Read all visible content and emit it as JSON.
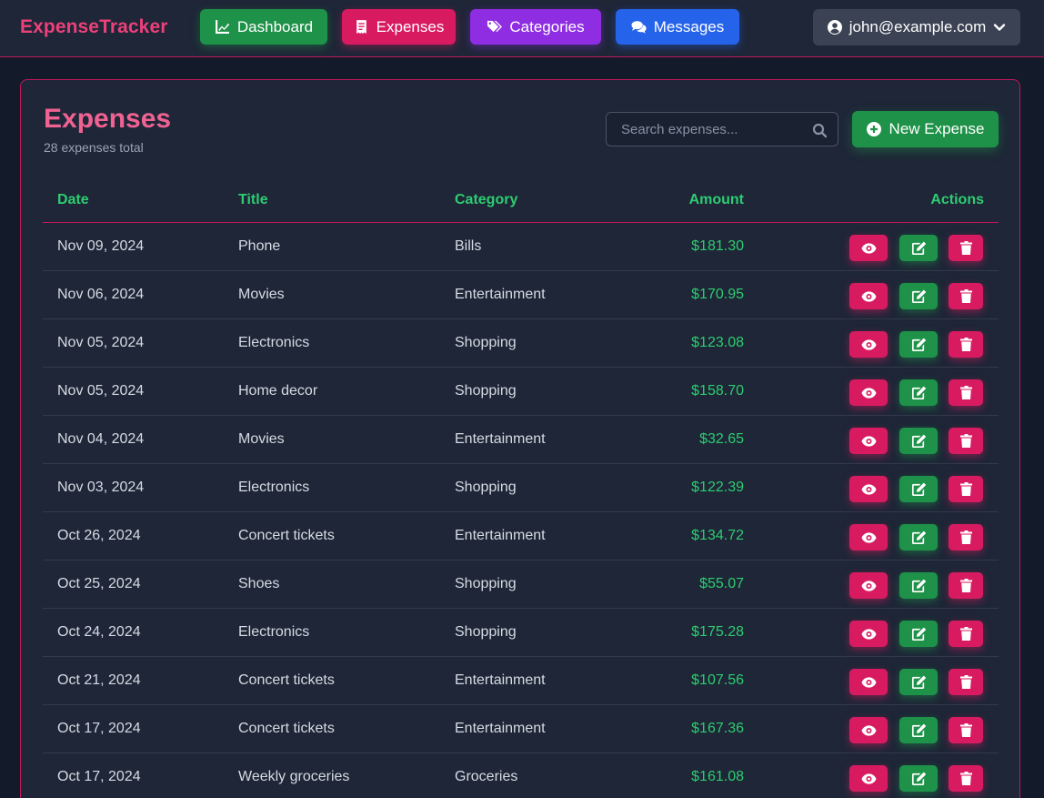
{
  "nav": {
    "brand": "ExpenseTracker",
    "items": [
      {
        "label": "Dashboard",
        "icon": "chart-line-icon"
      },
      {
        "label": "Expenses",
        "icon": "receipt-icon"
      },
      {
        "label": "Categories",
        "icon": "tags-icon"
      },
      {
        "label": "Messages",
        "icon": "comments-icon"
      }
    ],
    "user": "john@example.com"
  },
  "page": {
    "title": "Expenses",
    "subtitle": "28 expenses total",
    "search_placeholder": "Search expenses...",
    "new_button": "New Expense"
  },
  "table": {
    "headers": [
      "Date",
      "Title",
      "Category",
      "Amount",
      "Actions"
    ],
    "rows": [
      {
        "date": "Nov 09, 2024",
        "title": "Phone",
        "category": "Bills",
        "amount": "$181.30"
      },
      {
        "date": "Nov 06, 2024",
        "title": "Movies",
        "category": "Entertainment",
        "amount": "$170.95"
      },
      {
        "date": "Nov 05, 2024",
        "title": "Electronics",
        "category": "Shopping",
        "amount": "$123.08"
      },
      {
        "date": "Nov 05, 2024",
        "title": "Home decor",
        "category": "Shopping",
        "amount": "$158.70"
      },
      {
        "date": "Nov 04, 2024",
        "title": "Movies",
        "category": "Entertainment",
        "amount": "$32.65"
      },
      {
        "date": "Nov 03, 2024",
        "title": "Electronics",
        "category": "Shopping",
        "amount": "$122.39"
      },
      {
        "date": "Oct 26, 2024",
        "title": "Concert tickets",
        "category": "Entertainment",
        "amount": "$134.72"
      },
      {
        "date": "Oct 25, 2024",
        "title": "Shoes",
        "category": "Shopping",
        "amount": "$55.07"
      },
      {
        "date": "Oct 24, 2024",
        "title": "Electronics",
        "category": "Shopping",
        "amount": "$175.28"
      },
      {
        "date": "Oct 21, 2024",
        "title": "Concert tickets",
        "category": "Entertainment",
        "amount": "$107.56"
      },
      {
        "date": "Oct 17, 2024",
        "title": "Concert tickets",
        "category": "Entertainment",
        "amount": "$167.36"
      },
      {
        "date": "Oct 17, 2024",
        "title": "Weekly groceries",
        "category": "Groceries",
        "amount": "$161.08"
      }
    ]
  },
  "colors": {
    "accent_pink": "#d81b60",
    "accent_green": "#1e9248",
    "accent_purple": "#8e2de2",
    "accent_blue": "#2563eb",
    "amount_green": "#2ecc71"
  }
}
